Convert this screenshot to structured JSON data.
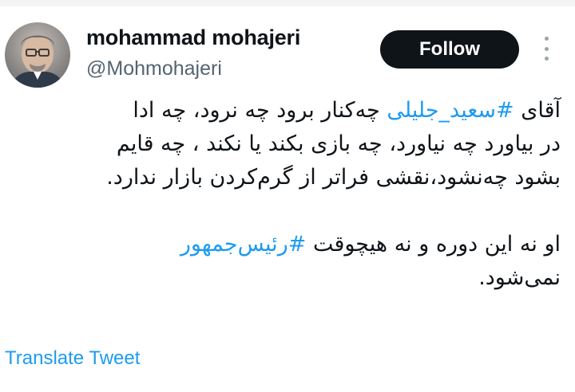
{
  "user": {
    "display_name": "mohammad mohajeri",
    "handle": "@Mohmohajeri"
  },
  "follow_button": {
    "label": "Follow"
  },
  "tweet": {
    "line1": {
      "pre": "آقای ",
      "tag": "#سعید_جلیلی",
      "post": "  چه‌کنار برود چه نرود، چه ادا"
    },
    "line2": "در بیاورد چه نیاورد،  چه بازی بکند یا نکند ، چه قایم",
    "line3": "بشود چه‌نشود،نقشی فراتر از گرم‌کردن بازار ندارد.",
    "line4": {
      "pre": "او نه این دوره و نه هیچوقت ",
      "tag": "#رئیس‌جمهور"
    },
    "line5": "نمی‌شود."
  },
  "translate": {
    "label": "Translate Tweet"
  },
  "colors": {
    "accent": "#1d9bf0",
    "button_bg": "#0f1419",
    "secondary_text": "#536471"
  },
  "icons": {
    "menu": "more-vertical-icon"
  }
}
